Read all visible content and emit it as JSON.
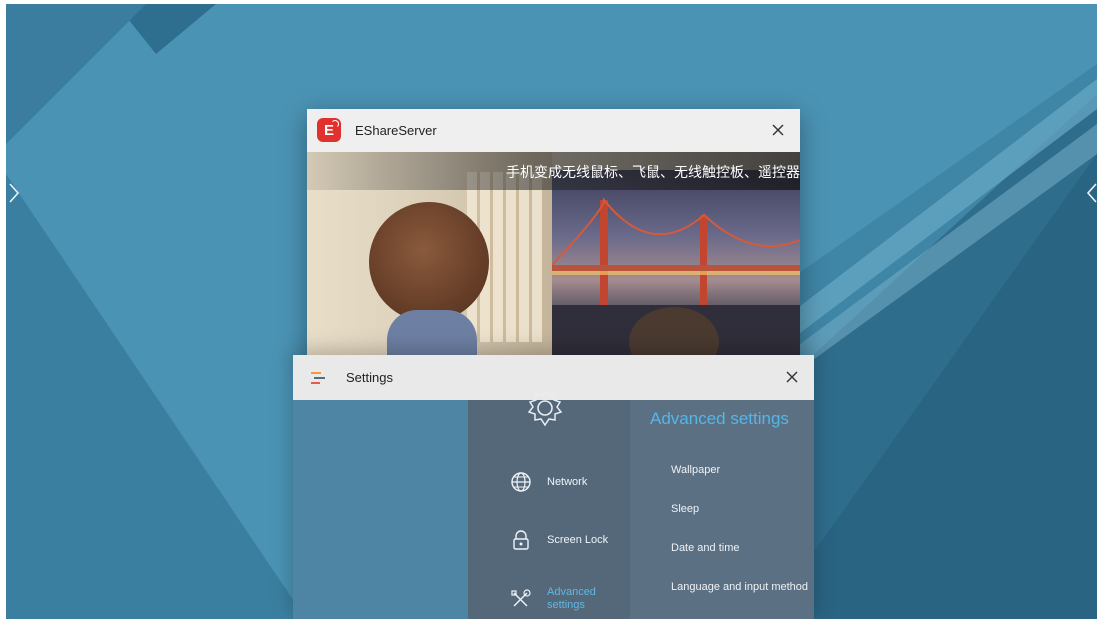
{
  "wallpaper": {
    "base_color": "#3f85a6"
  },
  "navigation": {
    "left_icon": "chevron-right-icon",
    "right_icon": "chevron-left-icon"
  },
  "recent_apps": [
    {
      "title": "EShareServer",
      "icon": "eshare-app-icon",
      "close_icon": "close-icon",
      "banner_text": "手机变成无线鼠标、飞鼠、无线触控板、遥控器"
    },
    {
      "title": "Settings",
      "icon": "settings-app-icon",
      "close_icon": "close-icon",
      "menu": [
        {
          "label": "Network",
          "icon": "globe-icon"
        },
        {
          "label": "Screen Lock",
          "icon": "lock-icon"
        },
        {
          "label": "Advanced settings",
          "icon": "tools-icon",
          "selected": true
        }
      ],
      "detail": {
        "heading": "Advanced settings",
        "items": [
          "Wallpaper",
          "Sleep",
          "Date and time",
          "Language and input method"
        ]
      },
      "accent_color": "#55b6e8"
    }
  ]
}
